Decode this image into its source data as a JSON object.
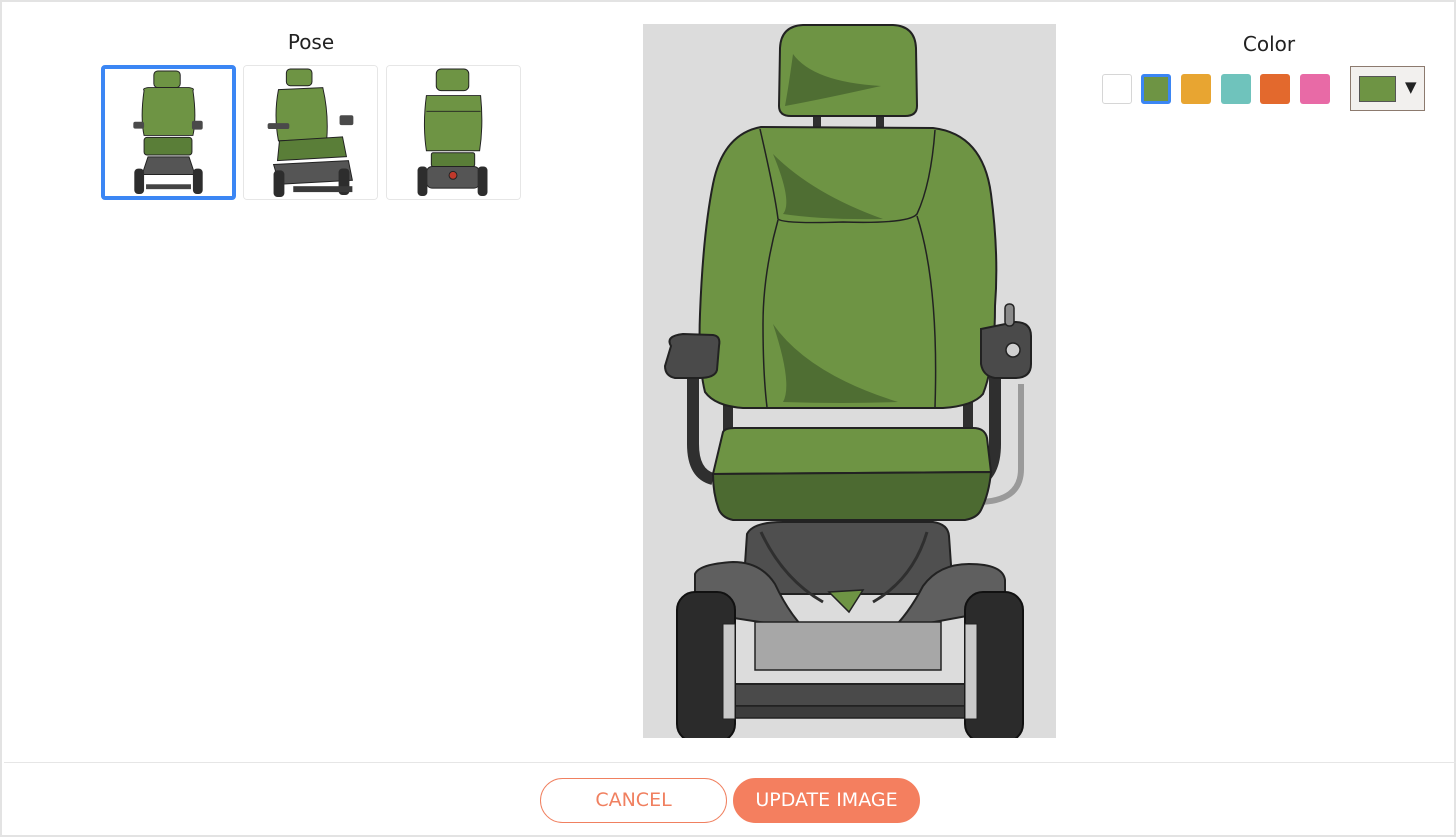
{
  "pose": {
    "title": "Pose",
    "selected_index": 0,
    "options": [
      "front",
      "three-quarter",
      "back"
    ]
  },
  "color": {
    "title": "Color",
    "selected": "#6e9444",
    "swatches": [
      "#ffffff",
      "#6e9444",
      "#e8a531",
      "#6fc3bc",
      "#e3692d",
      "#e86aa6"
    ],
    "picker_value": "#6e9444"
  },
  "actions": {
    "cancel_label": "CANCEL",
    "update_label": "UPDATE IMAGE"
  },
  "colors": {
    "accent_blue": "#3b86f4",
    "accent_orange": "#f47f5f",
    "seat_green": "#6e9444",
    "seat_dark": "#4c6a31",
    "frame_gray": "#4a4a4a"
  }
}
